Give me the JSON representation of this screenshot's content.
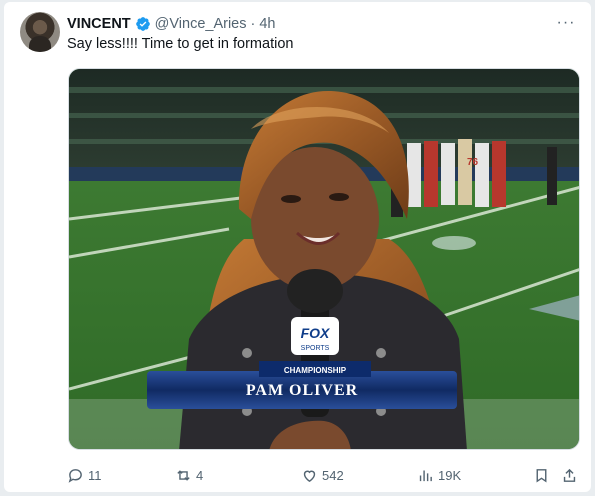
{
  "tweet": {
    "display_name": "VINCENT",
    "handle": "@Vince_Aries",
    "separator": "·",
    "time": "4h",
    "text": "Say less!!!! Time to get in formation",
    "more_label": "···"
  },
  "media": {
    "lower_third_name": "PAM OLIVER",
    "lower_third_tag": "CHAMPIONSHIP",
    "network": "FOX",
    "network_sub": "SPORTS",
    "jersey_number": "76"
  },
  "actions": {
    "replies": "11",
    "reposts": "4",
    "likes": "542",
    "views": "19K"
  },
  "colors": {
    "verified": "#1d9bf0",
    "muted_text": "#536471",
    "primary_text": "#0f1419"
  },
  "icons": [
    "verified-badge-icon",
    "more-icon",
    "reply-icon",
    "repost-icon",
    "like-icon",
    "views-icon",
    "bookmark-icon",
    "share-icon"
  ]
}
